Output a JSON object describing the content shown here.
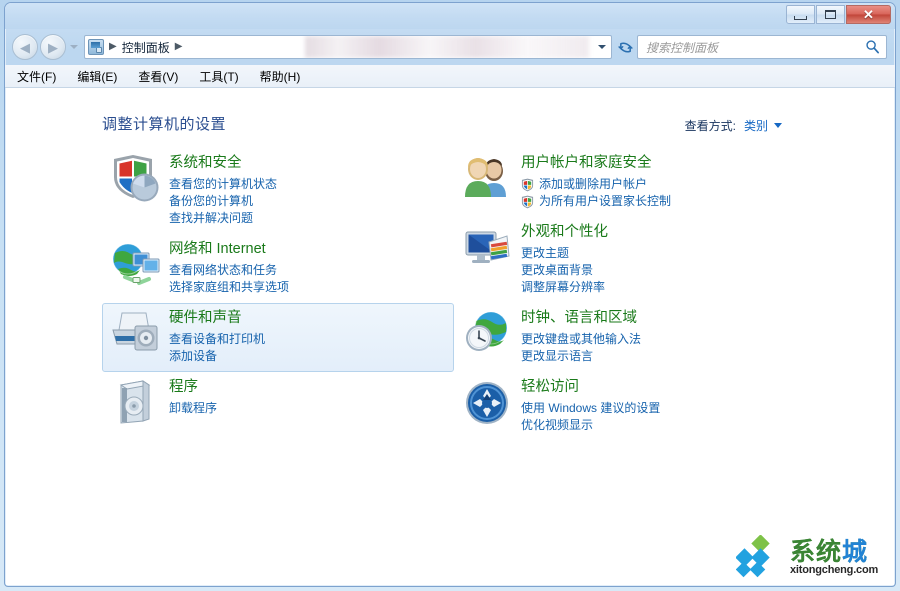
{
  "window": {
    "controls": {
      "minimize": "最小化",
      "maximize": "最大化",
      "close": "关闭"
    }
  },
  "navbar": {
    "back": "后退",
    "forward": "前进",
    "recent_pages": "最近浏览的页面",
    "breadcrumb": [
      "控制面板"
    ],
    "refresh": "刷新",
    "search_placeholder": "搜索控制面板",
    "search_value": ""
  },
  "menubar": {
    "items": [
      {
        "label": "文件(F)"
      },
      {
        "label": "编辑(E)"
      },
      {
        "label": "查看(V)"
      },
      {
        "label": "工具(T)"
      },
      {
        "label": "帮助(H)"
      }
    ]
  },
  "content": {
    "page_title": "调整计算机的设置",
    "view_by": {
      "label": "查看方式:",
      "value": "类别"
    },
    "categories_left": [
      {
        "title": "系统和安全",
        "icon": "shield-disk-icon",
        "links": [
          {
            "label": "查看您的计算机状态",
            "shield": false
          },
          {
            "label": "备份您的计算机",
            "shield": false
          },
          {
            "label": "查找并解决问题",
            "shield": false
          }
        ],
        "hover": false
      },
      {
        "title": "网络和 Internet",
        "icon": "globe-network-icon",
        "links": [
          {
            "label": "查看网络状态和任务",
            "shield": false
          },
          {
            "label": "选择家庭组和共享选项",
            "shield": false
          }
        ],
        "hover": false
      },
      {
        "title": "硬件和声音",
        "icon": "printer-icon",
        "links": [
          {
            "label": "查看设备和打印机",
            "shield": false
          },
          {
            "label": "添加设备",
            "shield": false
          }
        ],
        "hover": true
      },
      {
        "title": "程序",
        "icon": "programs-box-icon",
        "links": [
          {
            "label": "卸载程序",
            "shield": false
          }
        ],
        "hover": false
      }
    ],
    "categories_right": [
      {
        "title": "用户帐户和家庭安全",
        "icon": "users-icon",
        "links": [
          {
            "label": "添加或删除用户帐户",
            "shield": true
          },
          {
            "label": "为所有用户设置家长控制",
            "shield": true
          }
        ],
        "hover": false
      },
      {
        "title": "外观和个性化",
        "icon": "appearance-monitor-icon",
        "links": [
          {
            "label": "更改主题",
            "shield": false
          },
          {
            "label": "更改桌面背景",
            "shield": false
          },
          {
            "label": "调整屏幕分辨率",
            "shield": false
          }
        ],
        "hover": false
      },
      {
        "title": "时钟、语言和区域",
        "icon": "clock-globe-icon",
        "links": [
          {
            "label": "更改键盘或其他输入法",
            "shield": false
          },
          {
            "label": "更改显示语言",
            "shield": false
          }
        ],
        "hover": false
      },
      {
        "title": "轻松访问",
        "icon": "ease-of-access-icon",
        "links": [
          {
            "label": "使用 Windows 建议的设置",
            "shield": false
          },
          {
            "label": "优化视频显示",
            "shield": false
          }
        ],
        "hover": false
      }
    ]
  },
  "watermark": {
    "cn_prefix": "系统",
    "cn_suffix": "城",
    "domain": "xitongcheng.com"
  },
  "colors": {
    "category_title": "#1a7a1a",
    "link": "#1763ad",
    "page_title": "#2a4d8f",
    "hover_border": "#b6d3ec",
    "close_button": "#c14539",
    "watermark_green": "#35822f",
    "watermark_blue": "#1b7fd4"
  }
}
